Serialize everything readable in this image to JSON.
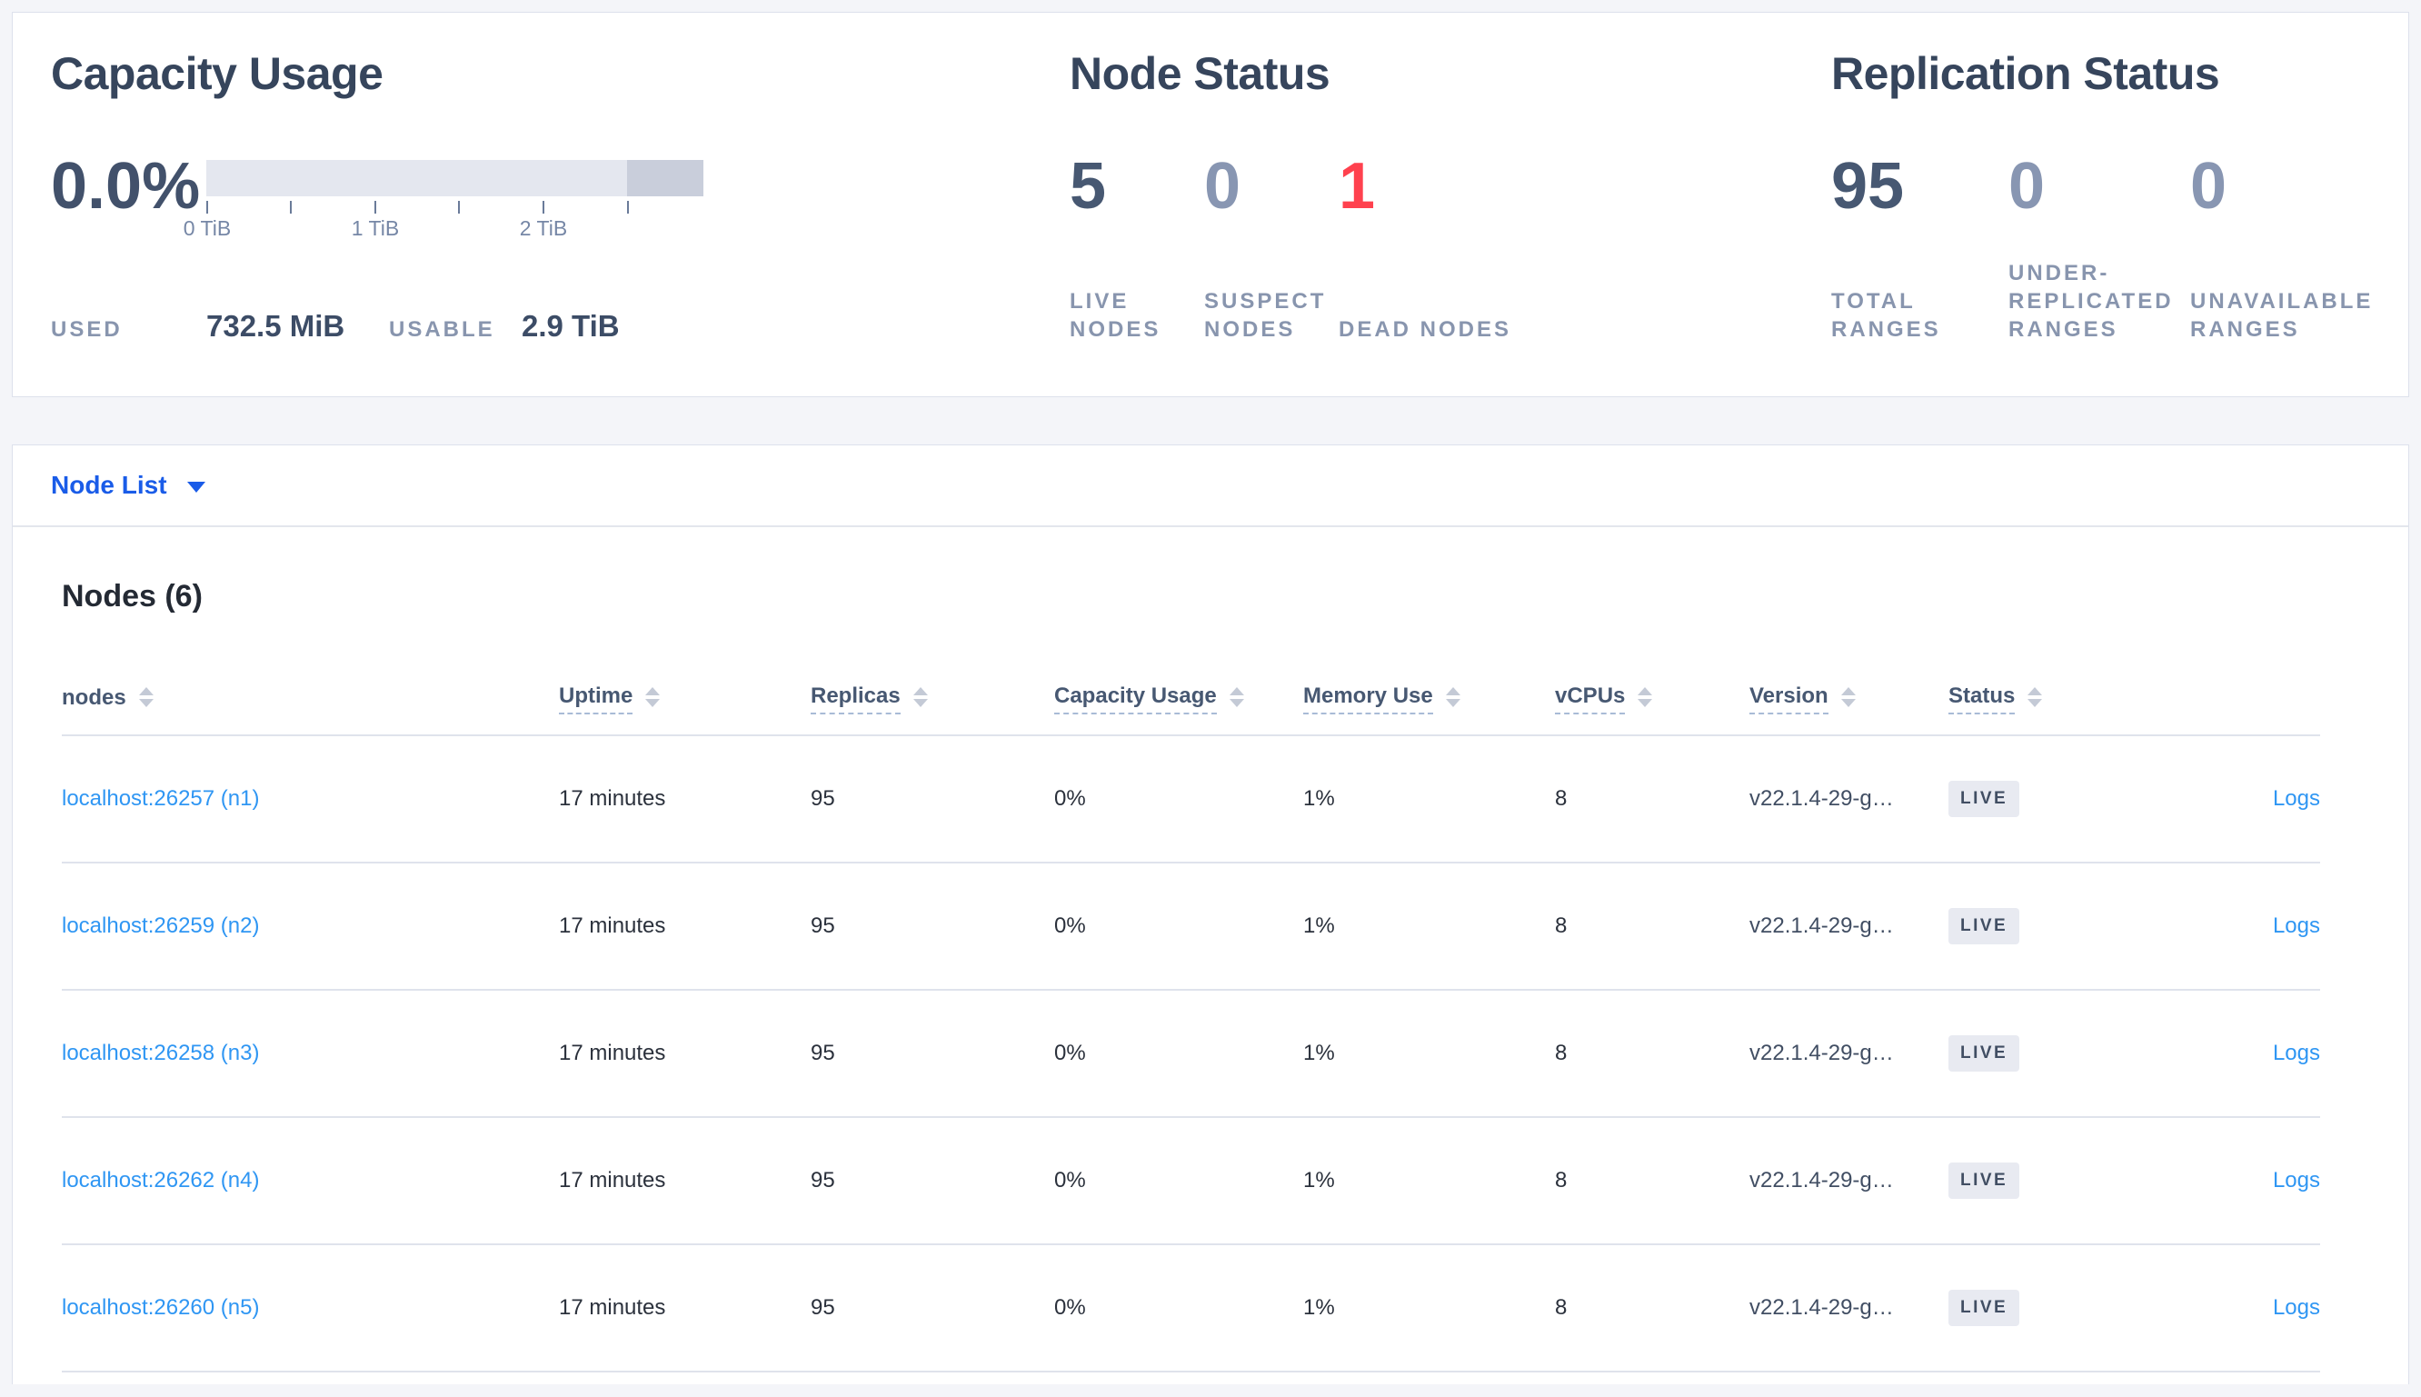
{
  "colors": {
    "stat_dark": "#475872",
    "stat_muted": "#8896b2",
    "stat_danger": "#ff414e",
    "link_blue": "#2f96f3",
    "node_list_blue": "#1a5ce8",
    "badge_bg": "#e8eaf1",
    "bar_light": "#e4e7ef",
    "bar_dark": "#c9cedb"
  },
  "capacity_panel": {
    "title": "Capacity Usage",
    "percent": "0.0%",
    "tick_labels": [
      "0 TiB",
      "1 TiB",
      "2 TiB"
    ],
    "used_label": "USED",
    "used_value": "732.5 MiB",
    "usable_label": "USABLE",
    "usable_value": "2.9 TiB"
  },
  "node_status_panel": {
    "title": "Node Status",
    "stats": [
      {
        "value": "5",
        "label": "LIVE NODES",
        "tone": "dark"
      },
      {
        "value": "0",
        "label": "SUSPECT NODES",
        "tone": "muted"
      },
      {
        "value": "1",
        "label": "DEAD NODES",
        "tone": "danger"
      }
    ]
  },
  "replication_panel": {
    "title": "Replication Status",
    "stats": [
      {
        "value": "95",
        "label": "TOTAL RANGES",
        "tone": "dark"
      },
      {
        "value": "0",
        "label": "UNDER-REPLICATED RANGES",
        "tone": "muted"
      },
      {
        "value": "0",
        "label": "UNAVAILABLE RANGES",
        "tone": "muted"
      }
    ]
  },
  "node_list_bar": {
    "label": "Node List"
  },
  "nodes_table": {
    "title": "Nodes (6)",
    "columns": [
      {
        "label": "nodes",
        "underline": false
      },
      {
        "label": "Uptime",
        "underline": true
      },
      {
        "label": "Replicas",
        "underline": true
      },
      {
        "label": "Capacity Usage",
        "underline": true
      },
      {
        "label": "Memory Use",
        "underline": true
      },
      {
        "label": "vCPUs",
        "underline": true
      },
      {
        "label": "Version",
        "underline": true
      },
      {
        "label": "Status",
        "underline": true
      }
    ],
    "rows": [
      {
        "node": "localhost:26257 (n1)",
        "uptime": "17 minutes",
        "replicas": "95",
        "capacity_usage": "0%",
        "memory_use": "1%",
        "vcpus": "8",
        "version": "v22.1.4-29-g…",
        "status": "LIVE",
        "logs": "Logs"
      },
      {
        "node": "localhost:26259 (n2)",
        "uptime": "17 minutes",
        "replicas": "95",
        "capacity_usage": "0%",
        "memory_use": "1%",
        "vcpus": "8",
        "version": "v22.1.4-29-g…",
        "status": "LIVE",
        "logs": "Logs"
      },
      {
        "node": "localhost:26258 (n3)",
        "uptime": "17 minutes",
        "replicas": "95",
        "capacity_usage": "0%",
        "memory_use": "1%",
        "vcpus": "8",
        "version": "v22.1.4-29-g…",
        "status": "LIVE",
        "logs": "Logs"
      },
      {
        "node": "localhost:26262 (n4)",
        "uptime": "17 minutes",
        "replicas": "95",
        "capacity_usage": "0%",
        "memory_use": "1%",
        "vcpus": "8",
        "version": "v22.1.4-29-g…",
        "status": "LIVE",
        "logs": "Logs"
      },
      {
        "node": "localhost:26260 (n5)",
        "uptime": "17 minutes",
        "replicas": "95",
        "capacity_usage": "0%",
        "memory_use": "1%",
        "vcpus": "8",
        "version": "v22.1.4-29-g…",
        "status": "LIVE",
        "logs": "Logs"
      }
    ]
  }
}
